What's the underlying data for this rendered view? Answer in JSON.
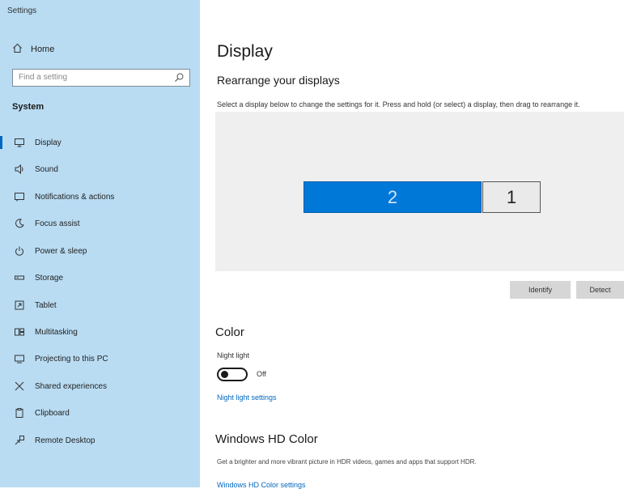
{
  "window": {
    "title": "Settings"
  },
  "sidebar": {
    "home_label": "Home",
    "search_placeholder": "Find a setting",
    "section_title": "System",
    "items": [
      {
        "label": "Display",
        "icon": "monitor-icon",
        "active": true
      },
      {
        "label": "Sound",
        "icon": "speaker-icon"
      },
      {
        "label": "Notifications & actions",
        "icon": "notification-icon"
      },
      {
        "label": "Focus assist",
        "icon": "moon-icon"
      },
      {
        "label": "Power & sleep",
        "icon": "power-icon"
      },
      {
        "label": "Storage",
        "icon": "storage-icon"
      },
      {
        "label": "Tablet",
        "icon": "tablet-icon"
      },
      {
        "label": "Multitasking",
        "icon": "multitasking-icon"
      },
      {
        "label": "Projecting to this PC",
        "icon": "projector-icon"
      },
      {
        "label": "Shared experiences",
        "icon": "shared-icon"
      },
      {
        "label": "Clipboard",
        "icon": "clipboard-icon"
      },
      {
        "label": "Remote Desktop",
        "icon": "remote-icon"
      }
    ]
  },
  "main": {
    "title": "Display",
    "rearrange_heading": "Rearrange your displays",
    "rearrange_desc": "Select a display below to change the settings for it. Press and hold (or select) a display, then drag to rearrange it.",
    "monitors": [
      {
        "number": "2",
        "selected": true
      },
      {
        "number": "1",
        "selected": false
      }
    ],
    "identify_button": "Identify",
    "detect_button": "Detect",
    "color_heading": "Color",
    "night_light_label": "Night light",
    "night_light_state": "Off",
    "night_light_settings_link": "Night light settings",
    "hdr_heading": "Windows HD Color",
    "hdr_desc": "Get a brighter and more vibrant picture in HDR videos, games and apps that support HDR.",
    "hdr_link": "Windows HD Color settings"
  },
  "colors": {
    "sidebar_bg": "#b9dcf3",
    "accent": "#0078d7",
    "link": "#0067c0"
  }
}
